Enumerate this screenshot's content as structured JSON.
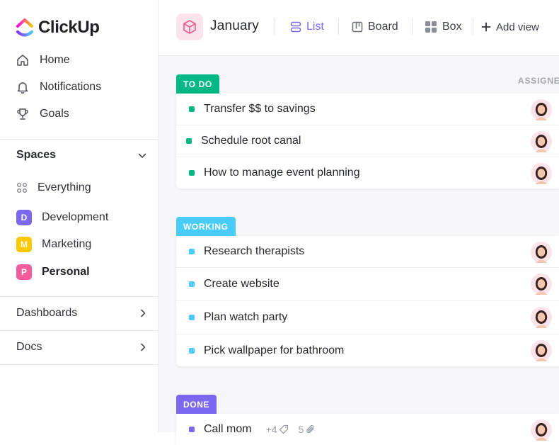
{
  "brand": {
    "name": "ClickUp"
  },
  "nav": {
    "items": [
      {
        "label": "Home",
        "icon": "home-icon"
      },
      {
        "label": "Notifications",
        "icon": "bell-icon"
      },
      {
        "label": "Goals",
        "icon": "trophy-icon"
      }
    ]
  },
  "spaces": {
    "title": "Spaces",
    "everything_label": "Everything",
    "items": [
      {
        "initial": "D",
        "label": "Development",
        "color": "#7b68ee"
      },
      {
        "initial": "M",
        "label": "Marketing",
        "color": "#ffc800"
      },
      {
        "initial": "P",
        "label": "Personal",
        "color": "#f35c9c"
      }
    ]
  },
  "links": [
    {
      "label": "Dashboards"
    },
    {
      "label": "Docs"
    }
  ],
  "header": {
    "title": "January",
    "views": [
      {
        "label": "List",
        "icon": "list-icon",
        "active": true
      },
      {
        "label": "Board",
        "icon": "board-icon"
      },
      {
        "label": "Box",
        "icon": "box-grid-icon"
      },
      {
        "label": "Add view",
        "icon": "plus-icon"
      }
    ]
  },
  "columns": {
    "assignee": "ASSIGNEE"
  },
  "groups": [
    {
      "status": "TO DO",
      "color": "#00b884",
      "tasks": [
        {
          "name": "Transfer $$ to savings"
        },
        {
          "name": "Schedule root canal"
        },
        {
          "name": "How to manage event planning"
        }
      ]
    },
    {
      "status": "WORKING",
      "color": "#49ccf9",
      "tasks": [
        {
          "name": "Research therapists"
        },
        {
          "name": "Create website"
        },
        {
          "name": "Plan watch party"
        },
        {
          "name": "Pick wallpaper for bathroom"
        }
      ]
    },
    {
      "status": "DONE",
      "color": "#7b68ee",
      "tasks": [
        {
          "name": "Call mom",
          "tags": "+4",
          "attachments": "5"
        }
      ]
    }
  ]
}
